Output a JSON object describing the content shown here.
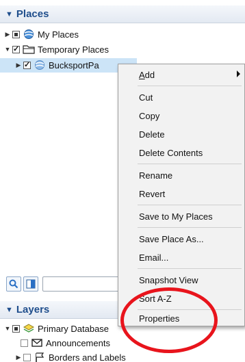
{
  "places_panel": {
    "title": "Places",
    "items": [
      {
        "label": "My Places",
        "expanded": false,
        "checked": "partial",
        "icon": "globe-icon"
      },
      {
        "label": "Temporary Places",
        "expanded": true,
        "checked": "checked",
        "icon": "folder-icon"
      },
      {
        "label": "BucksportPa",
        "expanded": false,
        "checked": "checked",
        "icon": "globe-icon",
        "selected": true
      }
    ]
  },
  "context_menu": {
    "items": [
      {
        "label_accel": "A",
        "label_rest": "dd",
        "has_submenu": true
      },
      {
        "label": "Cut"
      },
      {
        "label": "Copy"
      },
      {
        "label": "Delete"
      },
      {
        "label": "Delete Contents"
      },
      {
        "label": "Rename"
      },
      {
        "label": "Revert"
      },
      {
        "label": "Save to My Places"
      },
      {
        "label": "Save Place As..."
      },
      {
        "label": "Email..."
      },
      {
        "label": "Snapshot View"
      },
      {
        "label": "Sort A-Z"
      },
      {
        "label": "Properties"
      }
    ]
  },
  "search": {
    "value": ""
  },
  "layers_panel": {
    "title": "Layers",
    "items": [
      {
        "label": "Primary Database",
        "expanded": true,
        "checked": "partial",
        "icon": "layers-icon"
      },
      {
        "label": "Announcements",
        "checked": "empty",
        "icon": "envelope-icon"
      },
      {
        "label": "Borders and Labels",
        "expanded": false,
        "checked": "empty",
        "icon": "flag-icon"
      }
    ]
  },
  "colors": {
    "header_text": "#1f4e8c",
    "selection": "#cce4f7",
    "annotation": "#e8141c",
    "menu_bg": "#f2f2f2"
  }
}
